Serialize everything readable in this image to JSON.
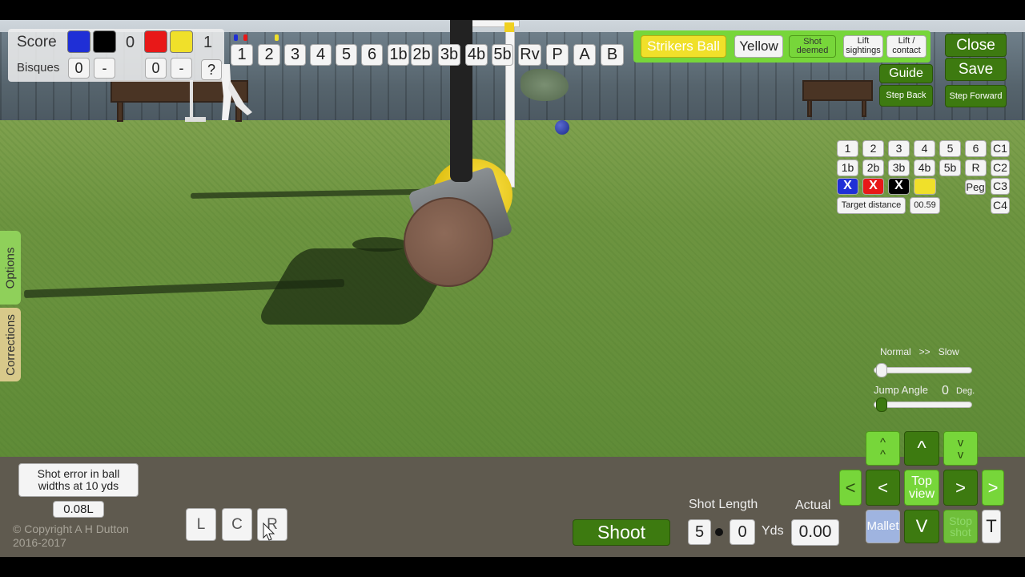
{
  "scoreboard": {
    "score_label": "Score",
    "bisques_label": "Bisques",
    "team1_colors": [
      "#1f2fd6",
      "#000000"
    ],
    "team2_colors": [
      "#e81818",
      "#f0e02a"
    ],
    "team1_score": "0",
    "team2_score": "1",
    "team1_bisques": "0",
    "team2_bisques": "0",
    "minus_label": "-",
    "help_label": "?"
  },
  "hoop_buttons": [
    "1",
    "2",
    "3",
    "4",
    "5",
    "6",
    "1b",
    "2b",
    "3b",
    "4b",
    "5b",
    "Rv",
    "P",
    "A",
    "B"
  ],
  "strike_panel": {
    "strikers_ball": "Strikers Ball",
    "ball_name": "Yellow",
    "shot_deemed": "Shot\ndeemed",
    "lift_sightings": "Lift\nsightings",
    "lift_contact": "Lift /\ncontact"
  },
  "right_buttons": {
    "close": "Close",
    "save": "Save",
    "guide": "Guide",
    "step_back": "Step Back",
    "step_forward": "Step Forward"
  },
  "target_grid": {
    "row1": [
      "1",
      "2",
      "3",
      "4",
      "5",
      "6",
      "C1"
    ],
    "row2": [
      "1b",
      "2b",
      "3b",
      "4b",
      "5b",
      "R",
      "C2"
    ],
    "peg": "Peg",
    "c3": "C3",
    "c4": "C4",
    "x_label": "X",
    "ball_colors": [
      "#1f2fd6",
      "#e81818",
      "#000000",
      "#f0e02a"
    ],
    "target_distance_label": "Target distance",
    "target_distance_value": "00.59"
  },
  "side_tabs": {
    "options": "Options",
    "corrections": "Corrections"
  },
  "speed": {
    "normal_slow_label": "Normal   >>   Slow",
    "speed_value": 0,
    "jump_angle_label": "Jump Angle",
    "jump_angle_value": "0",
    "deg_label": "Deg."
  },
  "shot_error": {
    "label": "Shot error in ball\nwidths at 10 yds",
    "value": "0.08L"
  },
  "copyright": "© Copyright A H Dutton\n2016-2017",
  "aim_buttons": [
    "L",
    "C",
    "R"
  ],
  "shoot_label": "Shoot",
  "shot_length": {
    "label": "Shot Length",
    "yds": "5",
    "feet": "0",
    "unit": "Yds",
    "actual_label": "Actual",
    "actual_value": "0.00"
  },
  "nav_pad": {
    "up_fast": "^\n^",
    "up": "^",
    "down_fast": "v\nv",
    "left_fast": "<",
    "left": "<",
    "top_view": "Top\nview",
    "right": ">",
    "right_fast": ">",
    "mallet": "Mallet",
    "down": "V",
    "stop_shot": "Stop\nshot",
    "t": "T"
  },
  "colors": {
    "dark_green": "#3d7a10",
    "light_green": "#77d63a",
    "yellow": "#f0e02a"
  }
}
